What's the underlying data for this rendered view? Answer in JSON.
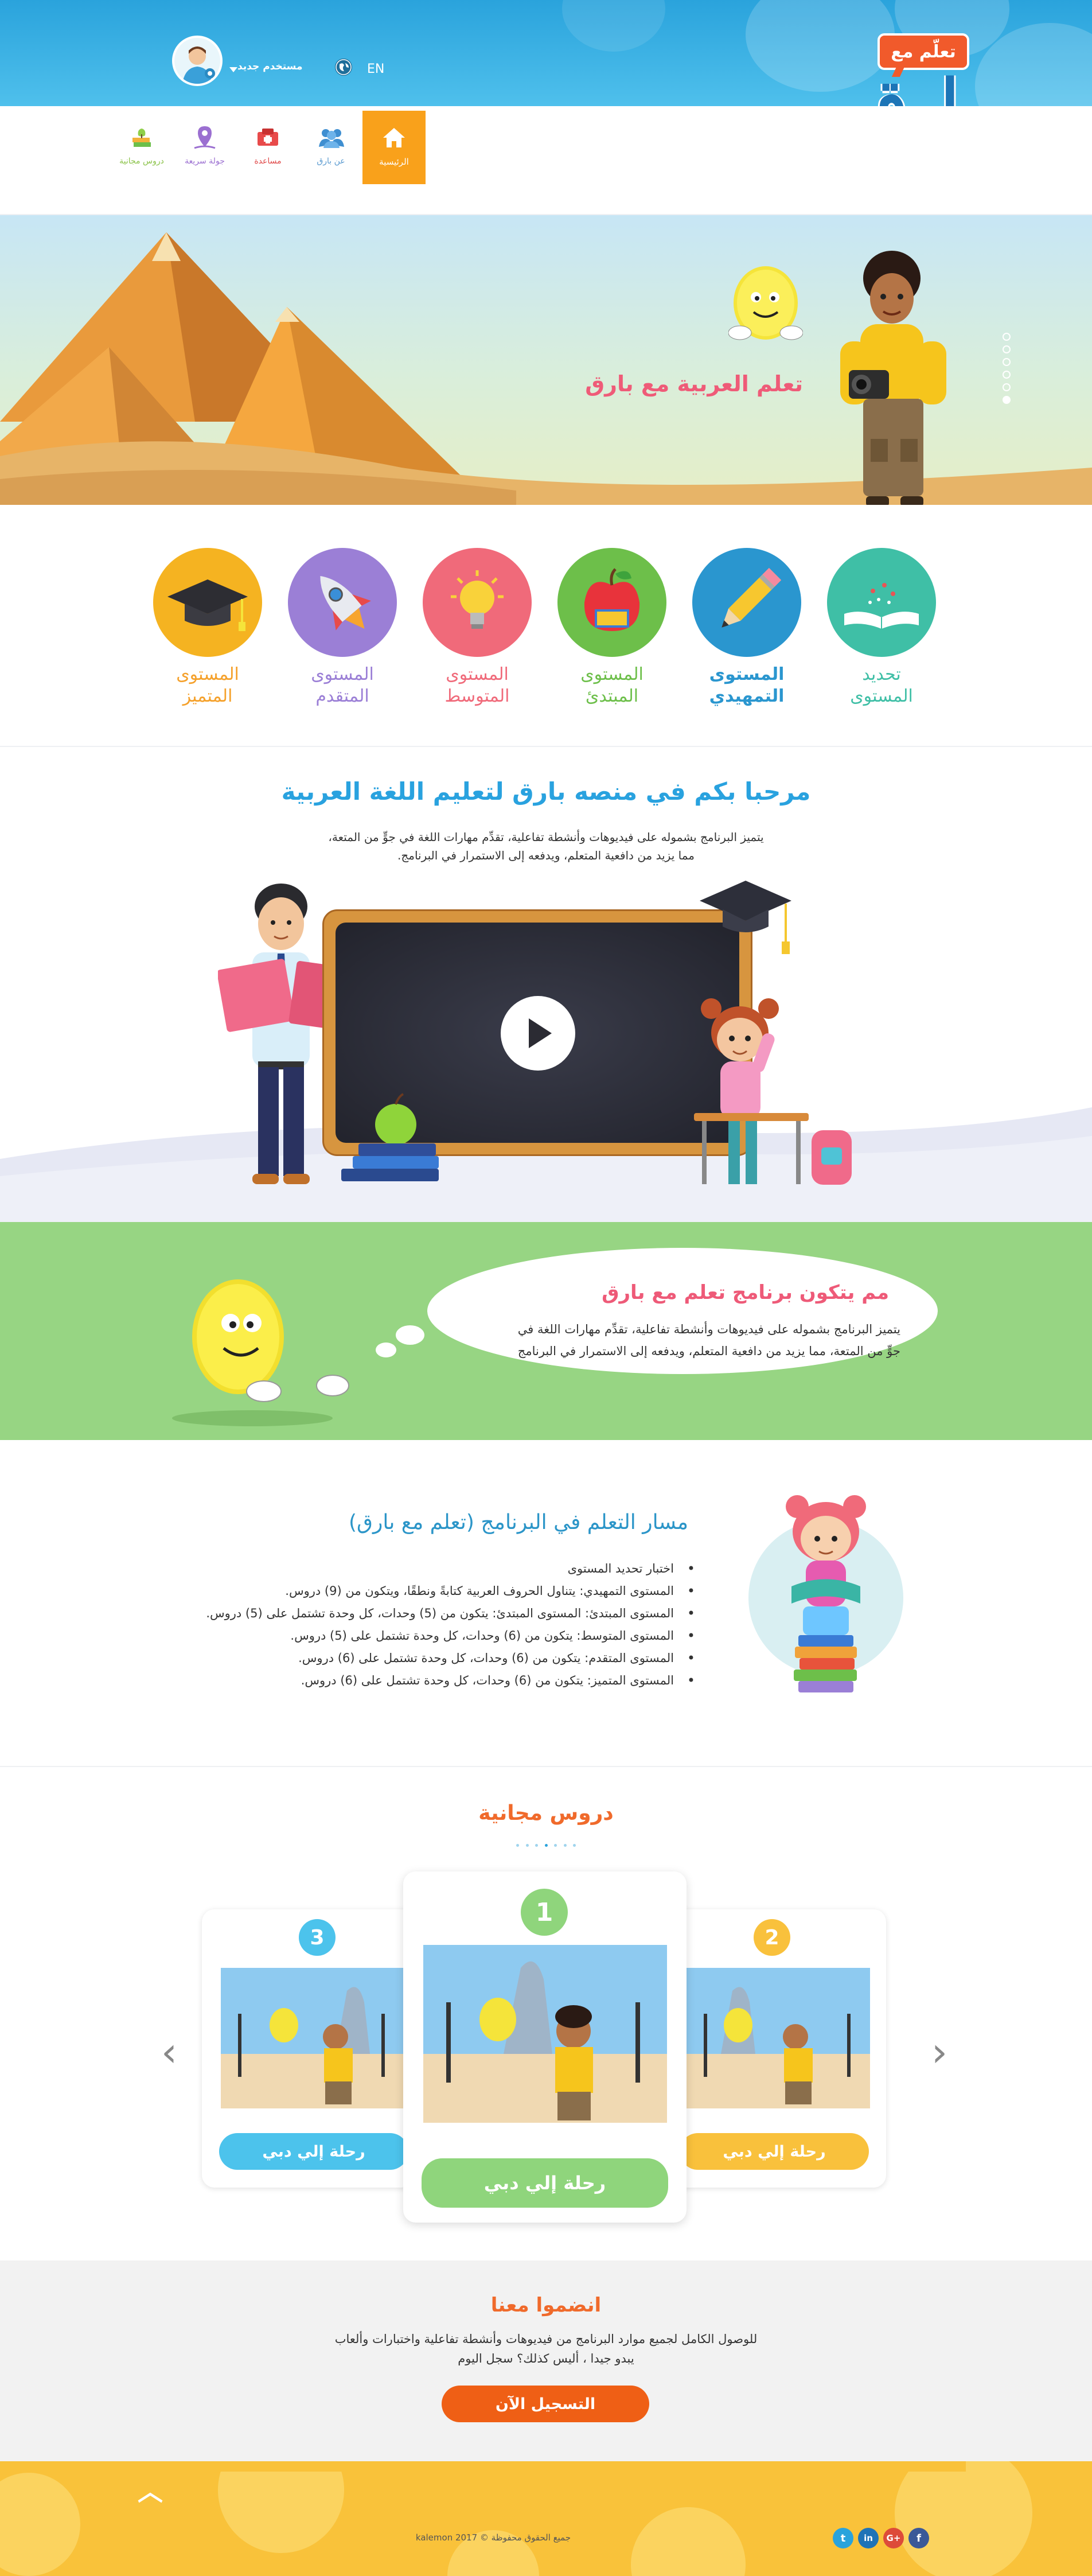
{
  "header": {
    "logo_small": "تعلّم مع",
    "logo_big": "بارق",
    "user_label": "مستخدم جديد",
    "language": "EN"
  },
  "nav": [
    {
      "label": "الرئيسية",
      "icon": "home-icon",
      "active": true
    },
    {
      "label": "عن بارق",
      "icon": "users-icon",
      "active": false
    },
    {
      "label": "مساعدة",
      "icon": "help-icon",
      "active": false
    },
    {
      "label": "جولة سريعة",
      "icon": "map-pin-icon",
      "active": false
    },
    {
      "label": "دروس مجانية",
      "icon": "lessons-icon",
      "active": false
    }
  ],
  "hero": {
    "title": "تعلم العربية مع بارق",
    "slides_count": 6,
    "active_slide": 6
  },
  "levels": [
    {
      "label_1": "تحديد",
      "label_2": "المستوى",
      "color": "#3fbfa6",
      "icon": "book-icon"
    },
    {
      "label_1": "المستوى",
      "label_2": "التمهيدي",
      "color": "#2a96cf",
      "icon": "pencil-icon"
    },
    {
      "label_1": "المستوى",
      "label_2": "المبتدئ",
      "color": "#6dbf4a",
      "icon": "apple-icon"
    },
    {
      "label_1": "المستوى",
      "label_2": "المتوسط",
      "color": "#f06a7a",
      "icon": "lightbulb-icon"
    },
    {
      "label_1": "المستوى",
      "label_2": "المتقدم",
      "color": "#9b7fd6",
      "icon": "rocket-icon"
    },
    {
      "label_1": "المستوى",
      "label_2": "المتميز",
      "color": "#f3a93a",
      "icon": "graduation-cap-icon"
    }
  ],
  "welcome": {
    "title": "مرحبا بكم في منصه بارق لتعليم اللغة العربية",
    "line1": "يتميز البرنامج بشموله على فيديوهات وأنشطة تفاعلية، تقدِّم مهارات اللغة في جوٍّ من المتعة،",
    "line2": "مما يزيد من دافعية المتعلم، ويدفعه إلى الاستمرار في البرنامج."
  },
  "program": {
    "title": "مم يتكون برنامج تعلم مع بارق",
    "line1": "يتميز البرنامج بشموله على فيديوهات وأنشطة تفاعلية، تقدِّم مهارات اللغة في",
    "line2": "جوٍّ من المتعة، مما يزيد من دافعية المتعلم، ويدفعه إلى الاستمرار في البرنامج"
  },
  "path": {
    "title": "مسار التعلم في البرنامج (تعلم مع بارق)",
    "items": [
      "اختبار تحديد المستوى",
      "المستوى التمهيدي: يتناول الحروف العربية كتابةً ونطقًا، ويتكون من (9) دروس.",
      "المستوى المبتدئ: المستوى المبتدئ: يتكون من (5) وحدات، كل وحدة تشتمل على (5) دروس.",
      "المستوى المتوسط: يتكون من (6) وحدات، كل وحدة تشتمل على (5) دروس.",
      "المستوى المتقدم: يتكون من (6) وحدات، كل وحدة تشتمل على (6) دروس.",
      "المستوى المتميز: يتكون من (6) وحدات، كل وحدة تشتمل على (6) دروس."
    ]
  },
  "lessons": {
    "title": "دروس مجانية",
    "cards": [
      {
        "number": "3",
        "label": "رحلة إلي دبي",
        "color": "#4cc3ec"
      },
      {
        "number": "1",
        "label": "رحلة إلي دبي",
        "color": "#8fd57c"
      },
      {
        "number": "2",
        "label": "رحلة إلي دبي",
        "color": "#f9c13c"
      }
    ],
    "prev_arrow": "‹",
    "next_arrow": "›"
  },
  "join": {
    "title": "انضموا معنا",
    "line1": "للوصول الكامل لجميع موارد البرنامج من فيديوهات وأنشطة تفاعلية واختبارات وألعاب",
    "line2": "يبدو جيدا ، أليس كذلك؟ سجل اليوم",
    "button": "التسجيل الآن"
  },
  "footer": {
    "copyright": "جميع الحقوق محفوظة © kalemon 2017",
    "social": [
      "t",
      "in",
      "G+",
      "f"
    ],
    "scroll_top": "︿"
  }
}
